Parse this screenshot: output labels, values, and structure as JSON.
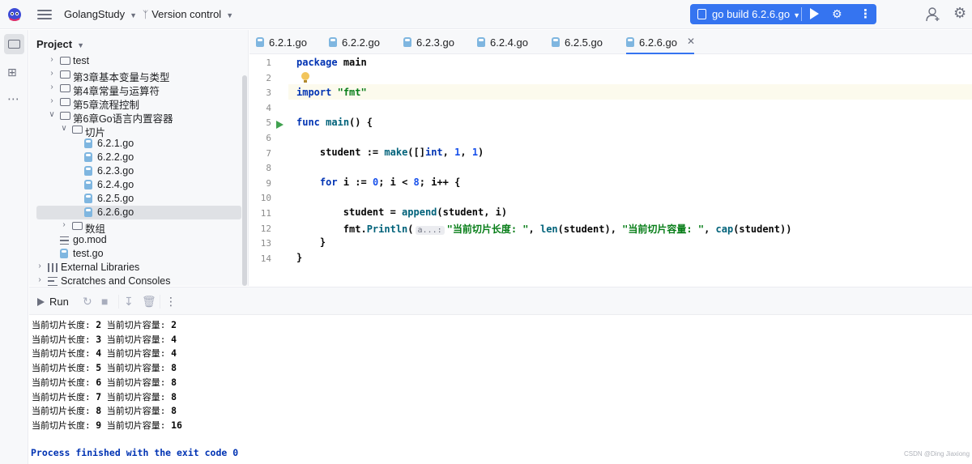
{
  "titlebar": {
    "project_name": "GolangStudy",
    "vcs_label": "Version control",
    "run_config_label": "go build 6.2.6.go",
    "run_icon": "play-icon",
    "debug_icon": "bug-icon",
    "more_icon": "more-vertical-icon",
    "user_icon": "user-icon",
    "settings_icon": "gear-icon"
  },
  "project_panel": {
    "title": "Project",
    "tree": [
      {
        "label": "test",
        "depth": 1,
        "type": "folder",
        "expanded": false
      },
      {
        "label": "第3章基本变量与类型",
        "depth": 1,
        "type": "folder",
        "expanded": false
      },
      {
        "label": "第4章常量与运算符",
        "depth": 1,
        "type": "folder",
        "expanded": false
      },
      {
        "label": "第5章流程控制",
        "depth": 1,
        "type": "folder",
        "expanded": false
      },
      {
        "label": "第6章Go语言内置容器",
        "depth": 1,
        "type": "folder",
        "expanded": true
      },
      {
        "label": "切片",
        "depth": 2,
        "type": "folder",
        "expanded": true
      },
      {
        "label": "6.2.1.go",
        "depth": 3,
        "type": "go"
      },
      {
        "label": "6.2.2.go",
        "depth": 3,
        "type": "go"
      },
      {
        "label": "6.2.3.go",
        "depth": 3,
        "type": "go"
      },
      {
        "label": "6.2.4.go",
        "depth": 3,
        "type": "go"
      },
      {
        "label": "6.2.5.go",
        "depth": 3,
        "type": "go"
      },
      {
        "label": "6.2.6.go",
        "depth": 3,
        "type": "go",
        "selected": true
      },
      {
        "label": "数组",
        "depth": 2,
        "type": "folder",
        "expanded": false
      },
      {
        "label": "go.mod",
        "depth": 1,
        "type": "mod"
      },
      {
        "label": "test.go",
        "depth": 1,
        "type": "go"
      },
      {
        "label": "External Libraries",
        "depth": 0,
        "type": "lib",
        "expanded": false
      },
      {
        "label": "Scratches and Consoles",
        "depth": 0,
        "type": "scratch",
        "expanded": false
      }
    ]
  },
  "tabs": [
    {
      "label": "6.2.1.go"
    },
    {
      "label": "6.2.2.go"
    },
    {
      "label": "6.2.3.go"
    },
    {
      "label": "6.2.4.go"
    },
    {
      "label": "6.2.5.go"
    },
    {
      "label": "6.2.6.go",
      "active": true
    }
  ],
  "editor": {
    "line_numbers": [
      "1",
      "2",
      "3",
      "4",
      "5",
      "6",
      "7",
      "8",
      "9",
      "10",
      "11",
      "12",
      "13",
      "14"
    ],
    "param_hint": "a...:",
    "code": {
      "l1_kw": "package",
      "l1_name": "main",
      "l3_kw": "import",
      "l3_str": "\"fmt\"",
      "l5_kw": "func",
      "l5_fn": "main",
      "l5_rest": "() {",
      "l7_a": "student := ",
      "l7_fn": "make",
      "l7_b": "([]",
      "l7_kw": "int",
      "l7_c": ", ",
      "l7_n1": "1",
      "l7_d": ", ",
      "l7_n2": "1",
      "l7_e": ")",
      "l9_kw": "for",
      "l9_a": " i := ",
      "l9_n0": "0",
      "l9_b": "; i < ",
      "l9_n8": "8",
      "l9_c": "; i++ {",
      "l11_a": "student = ",
      "l11_fn": "append",
      "l11_b": "(student, i)",
      "l12_pkg": "fmt.",
      "l12_fn": "Println",
      "l12_a": "(",
      "l12_s1": "\"当前切片长度: \"",
      "l12_b": ", ",
      "l12_fn2": "len",
      "l12_c": "(student), ",
      "l12_s2": "\"当前切片容量: \"",
      "l12_d": ", ",
      "l12_fn3": "cap",
      "l12_e": "(student))",
      "l13": "}",
      "l14": "}"
    }
  },
  "run_panel": {
    "title": "Run",
    "len_label": "当前切片长度: ",
    "cap_label": " 当前切片容量: ",
    "output": [
      {
        "len": "2",
        "cap": "2"
      },
      {
        "len": "3",
        "cap": "4"
      },
      {
        "len": "4",
        "cap": "4"
      },
      {
        "len": "5",
        "cap": "8"
      },
      {
        "len": "6",
        "cap": "8"
      },
      {
        "len": "7",
        "cap": "8"
      },
      {
        "len": "8",
        "cap": "8"
      },
      {
        "len": "9",
        "cap": "16"
      }
    ],
    "exit_message": "Process finished with the exit code 0",
    "watermark": "CSDN @Ding Jiaxiong"
  }
}
